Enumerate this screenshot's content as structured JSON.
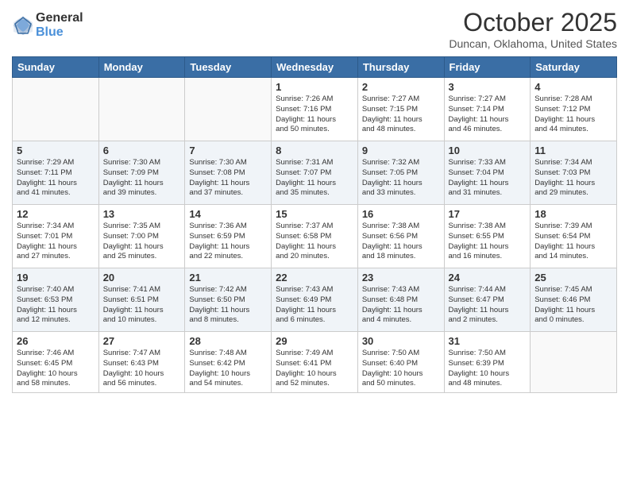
{
  "header": {
    "logo_general": "General",
    "logo_blue": "Blue",
    "month_title": "October 2025",
    "location": "Duncan, Oklahoma, United States"
  },
  "days_of_week": [
    "Sunday",
    "Monday",
    "Tuesday",
    "Wednesday",
    "Thursday",
    "Friday",
    "Saturday"
  ],
  "weeks": [
    [
      {
        "day": "",
        "info": ""
      },
      {
        "day": "",
        "info": ""
      },
      {
        "day": "",
        "info": ""
      },
      {
        "day": "1",
        "info": "Sunrise: 7:26 AM\nSunset: 7:16 PM\nDaylight: 11 hours\nand 50 minutes."
      },
      {
        "day": "2",
        "info": "Sunrise: 7:27 AM\nSunset: 7:15 PM\nDaylight: 11 hours\nand 48 minutes."
      },
      {
        "day": "3",
        "info": "Sunrise: 7:27 AM\nSunset: 7:14 PM\nDaylight: 11 hours\nand 46 minutes."
      },
      {
        "day": "4",
        "info": "Sunrise: 7:28 AM\nSunset: 7:12 PM\nDaylight: 11 hours\nand 44 minutes."
      }
    ],
    [
      {
        "day": "5",
        "info": "Sunrise: 7:29 AM\nSunset: 7:11 PM\nDaylight: 11 hours\nand 41 minutes."
      },
      {
        "day": "6",
        "info": "Sunrise: 7:30 AM\nSunset: 7:09 PM\nDaylight: 11 hours\nand 39 minutes."
      },
      {
        "day": "7",
        "info": "Sunrise: 7:30 AM\nSunset: 7:08 PM\nDaylight: 11 hours\nand 37 minutes."
      },
      {
        "day": "8",
        "info": "Sunrise: 7:31 AM\nSunset: 7:07 PM\nDaylight: 11 hours\nand 35 minutes."
      },
      {
        "day": "9",
        "info": "Sunrise: 7:32 AM\nSunset: 7:05 PM\nDaylight: 11 hours\nand 33 minutes."
      },
      {
        "day": "10",
        "info": "Sunrise: 7:33 AM\nSunset: 7:04 PM\nDaylight: 11 hours\nand 31 minutes."
      },
      {
        "day": "11",
        "info": "Sunrise: 7:34 AM\nSunset: 7:03 PM\nDaylight: 11 hours\nand 29 minutes."
      }
    ],
    [
      {
        "day": "12",
        "info": "Sunrise: 7:34 AM\nSunset: 7:01 PM\nDaylight: 11 hours\nand 27 minutes."
      },
      {
        "day": "13",
        "info": "Sunrise: 7:35 AM\nSunset: 7:00 PM\nDaylight: 11 hours\nand 25 minutes."
      },
      {
        "day": "14",
        "info": "Sunrise: 7:36 AM\nSunset: 6:59 PM\nDaylight: 11 hours\nand 22 minutes."
      },
      {
        "day": "15",
        "info": "Sunrise: 7:37 AM\nSunset: 6:58 PM\nDaylight: 11 hours\nand 20 minutes."
      },
      {
        "day": "16",
        "info": "Sunrise: 7:38 AM\nSunset: 6:56 PM\nDaylight: 11 hours\nand 18 minutes."
      },
      {
        "day": "17",
        "info": "Sunrise: 7:38 AM\nSunset: 6:55 PM\nDaylight: 11 hours\nand 16 minutes."
      },
      {
        "day": "18",
        "info": "Sunrise: 7:39 AM\nSunset: 6:54 PM\nDaylight: 11 hours\nand 14 minutes."
      }
    ],
    [
      {
        "day": "19",
        "info": "Sunrise: 7:40 AM\nSunset: 6:53 PM\nDaylight: 11 hours\nand 12 minutes."
      },
      {
        "day": "20",
        "info": "Sunrise: 7:41 AM\nSunset: 6:51 PM\nDaylight: 11 hours\nand 10 minutes."
      },
      {
        "day": "21",
        "info": "Sunrise: 7:42 AM\nSunset: 6:50 PM\nDaylight: 11 hours\nand 8 minutes."
      },
      {
        "day": "22",
        "info": "Sunrise: 7:43 AM\nSunset: 6:49 PM\nDaylight: 11 hours\nand 6 minutes."
      },
      {
        "day": "23",
        "info": "Sunrise: 7:43 AM\nSunset: 6:48 PM\nDaylight: 11 hours\nand 4 minutes."
      },
      {
        "day": "24",
        "info": "Sunrise: 7:44 AM\nSunset: 6:47 PM\nDaylight: 11 hours\nand 2 minutes."
      },
      {
        "day": "25",
        "info": "Sunrise: 7:45 AM\nSunset: 6:46 PM\nDaylight: 11 hours\nand 0 minutes."
      }
    ],
    [
      {
        "day": "26",
        "info": "Sunrise: 7:46 AM\nSunset: 6:45 PM\nDaylight: 10 hours\nand 58 minutes."
      },
      {
        "day": "27",
        "info": "Sunrise: 7:47 AM\nSunset: 6:43 PM\nDaylight: 10 hours\nand 56 minutes."
      },
      {
        "day": "28",
        "info": "Sunrise: 7:48 AM\nSunset: 6:42 PM\nDaylight: 10 hours\nand 54 minutes."
      },
      {
        "day": "29",
        "info": "Sunrise: 7:49 AM\nSunset: 6:41 PM\nDaylight: 10 hours\nand 52 minutes."
      },
      {
        "day": "30",
        "info": "Sunrise: 7:50 AM\nSunset: 6:40 PM\nDaylight: 10 hours\nand 50 minutes."
      },
      {
        "day": "31",
        "info": "Sunrise: 7:50 AM\nSunset: 6:39 PM\nDaylight: 10 hours\nand 48 minutes."
      },
      {
        "day": "",
        "info": ""
      }
    ]
  ]
}
